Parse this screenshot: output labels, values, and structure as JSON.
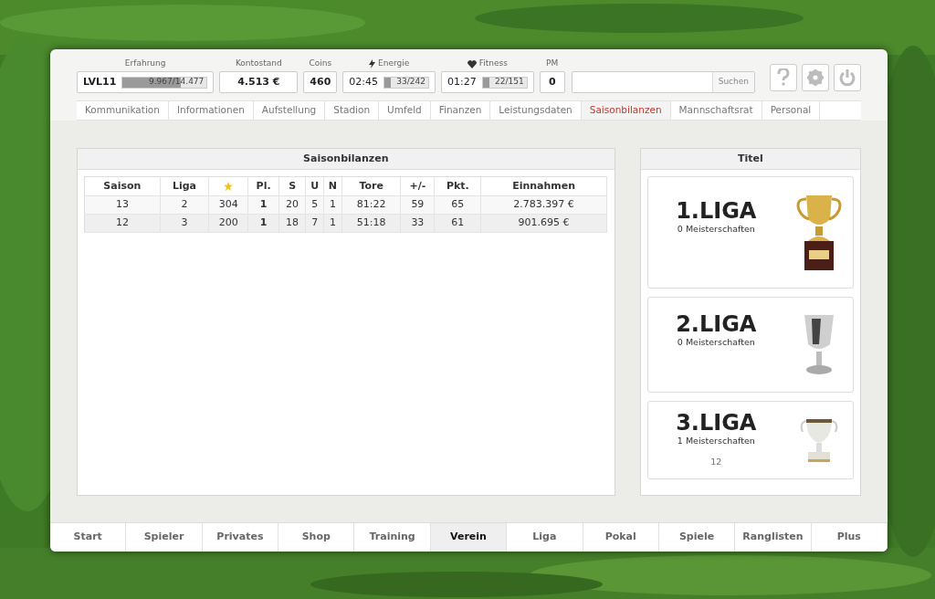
{
  "stats": [
    {
      "kind": "level",
      "label": "Erfahrung",
      "prefix": "LVL11",
      "bar_text": "9.967/14.477",
      "level": 0.69
    },
    {
      "kind": "value",
      "label": "Kontostand",
      "value": "4.513 €"
    },
    {
      "kind": "value",
      "label": "Coins",
      "value": "460"
    },
    {
      "kind": "timer",
      "label": "Energie",
      "time": "02:45",
      "bar_text": "33/242",
      "level": 0.14
    },
    {
      "kind": "timer",
      "label": "Fitness",
      "time": "01:27",
      "bar_text": "22/151",
      "level": 0.15
    },
    {
      "kind": "value",
      "label": "PM",
      "value": "0"
    }
  ],
  "search": {
    "button": "Suchen"
  },
  "subnav": [
    {
      "label": "Kommunikation",
      "selected": false
    },
    {
      "label": "Informationen",
      "selected": false
    },
    {
      "label": "Aufstellung",
      "selected": false
    },
    {
      "label": "Stadion",
      "selected": false
    },
    {
      "label": "Umfeld",
      "selected": false
    },
    {
      "label": "Finanzen",
      "selected": false
    },
    {
      "label": "Leistungsdaten",
      "selected": false
    },
    {
      "label": "Saisonbilanzen",
      "selected": true
    },
    {
      "label": "Mannschaftsrat",
      "selected": false
    },
    {
      "label": "Personal",
      "selected": false
    }
  ],
  "saison_panel": {
    "title": "Saisonbilanzen",
    "columns": [
      {
        "label": "Saison"
      },
      {
        "label": "Liga"
      },
      {
        "kind": "star"
      },
      {
        "label": "Pl."
      },
      {
        "label": "S"
      },
      {
        "label": "U"
      },
      {
        "label": "N"
      },
      {
        "label": "Tore"
      },
      {
        "label": "+/-"
      },
      {
        "label": "Pkt."
      },
      {
        "label": "Einnahmen"
      }
    ],
    "rows": [
      [
        "13",
        "2",
        "304",
        "1",
        "20",
        "5",
        "1",
        "81:22",
        "59",
        "65",
        "2.783.397 €"
      ],
      [
        "12",
        "3",
        "200",
        "1",
        "18",
        "7",
        "1",
        "51:18",
        "33",
        "61",
        "901.695 €"
      ]
    ]
  },
  "titles_panel": {
    "title": "Titel",
    "cards": [
      {
        "league": "1.LIGA",
        "count": "0 Meisterschaften"
      },
      {
        "league": "2.LIGA",
        "count": "0 Meisterschaften"
      },
      {
        "league": "3.LIGA",
        "count": "1 Meisterschaften",
        "seasons": "12"
      }
    ]
  },
  "bottom_nav": [
    {
      "label": "Start",
      "selected": false
    },
    {
      "label": "Spieler",
      "selected": false
    },
    {
      "label": "Privates",
      "selected": false
    },
    {
      "label": "Shop",
      "selected": false
    },
    {
      "label": "Training",
      "selected": false
    },
    {
      "label": "Verein",
      "selected": true
    },
    {
      "label": "Liga",
      "selected": false
    },
    {
      "label": "Pokal",
      "selected": false
    },
    {
      "label": "Spiele",
      "selected": false
    },
    {
      "label": "Ranglisten",
      "selected": false
    },
    {
      "label": "Plus",
      "selected": false
    }
  ]
}
